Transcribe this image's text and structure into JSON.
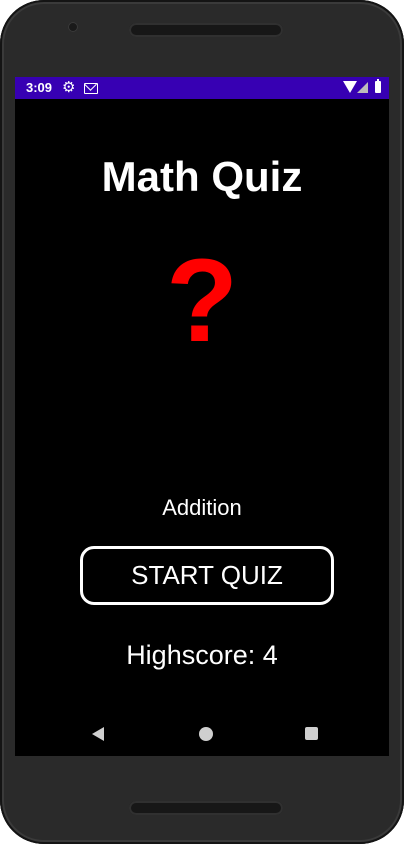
{
  "status_bar": {
    "time": "3:09",
    "icons": [
      "gear-icon",
      "mail-icon",
      "wifi-icon",
      "signal-icon",
      "battery-icon"
    ],
    "background": "#3700b3"
  },
  "app": {
    "title": "Math Quiz",
    "question_mark": "?",
    "question_mark_color": "#ff0000",
    "mode": "Addition",
    "start_button_label": "START QUIZ",
    "highscore_label": "Highscore:",
    "highscore_value": "4"
  },
  "nav_bar": {
    "buttons": [
      "back-icon",
      "home-icon",
      "recents-icon"
    ]
  }
}
